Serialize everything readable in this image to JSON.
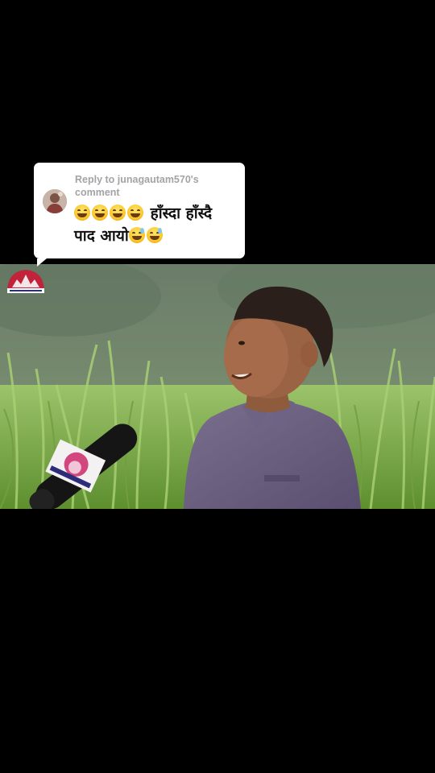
{
  "reply": {
    "label": "Reply to junagautam570's comment",
    "line1_text": "हाँस्दा हाँस्दै",
    "line2_text": "पाद आयो"
  },
  "icons": {
    "avatar": "user-avatar",
    "grin_emoji": "grinning-squinting-face",
    "sweat_emoji": "grinning-face-with-sweat",
    "channel_logo": "channel-logo",
    "microphone": "microphone"
  },
  "colors": {
    "background": "#000000",
    "card": "#ffffff",
    "label": "#a3a3a8",
    "text": "#111111"
  }
}
